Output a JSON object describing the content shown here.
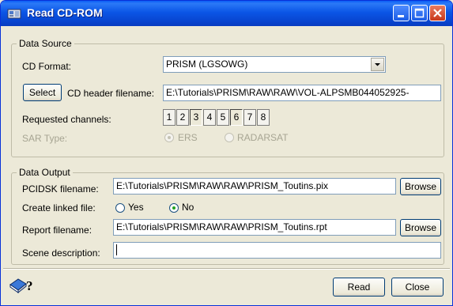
{
  "window": {
    "title": "Read CD-ROM",
    "controls": [
      "minimize",
      "maximize",
      "close"
    ]
  },
  "data_source": {
    "legend": "Data Source",
    "cd_format_label": "CD Format:",
    "cd_format_value": "PRISM (LGSOWG)",
    "select_button": "Select",
    "cd_header_label": "CD header filename:",
    "cd_header_value": "E:\\Tutorials\\PRISM\\RAW\\RAW\\VOL-ALPSMB044052925-",
    "channels_label": "Requested channels:",
    "channels": [
      {
        "label": "1",
        "pressed": false
      },
      {
        "label": "2",
        "pressed": false
      },
      {
        "label": "3",
        "pressed": true
      },
      {
        "label": "4",
        "pressed": false
      },
      {
        "label": "5",
        "pressed": false
      },
      {
        "label": "6",
        "pressed": true
      },
      {
        "label": "7",
        "pressed": false
      },
      {
        "label": "8",
        "pressed": false
      }
    ],
    "sar_type_label": "SAR Type:",
    "sar_options": [
      "ERS",
      "RADARSAT"
    ],
    "sar_selected": "ERS"
  },
  "data_output": {
    "legend": "Data Output",
    "pcidsk_label": "PCIDSK filename:",
    "pcidsk_value": "E:\\Tutorials\\PRISM\\RAW\\RAW\\PRISM_Toutins.pix",
    "browse_label": "Browse",
    "linked_label": "Create linked file:",
    "linked_options": [
      "Yes",
      "No"
    ],
    "linked_selected": "No",
    "report_label": "Report filename:",
    "report_value": "E:\\Tutorials\\PRISM\\RAW\\RAW\\PRISM_Toutins.rpt",
    "scene_label": "Scene description:",
    "scene_value": ""
  },
  "footer": {
    "help_icon": "help-book-icon",
    "read_button": "Read",
    "close_button": "Close"
  },
  "colors": {
    "titlebar": "#0b56e6",
    "window_bg": "#ece9d8",
    "field_border": "#7f9db9",
    "close_button": "#c8381a"
  }
}
